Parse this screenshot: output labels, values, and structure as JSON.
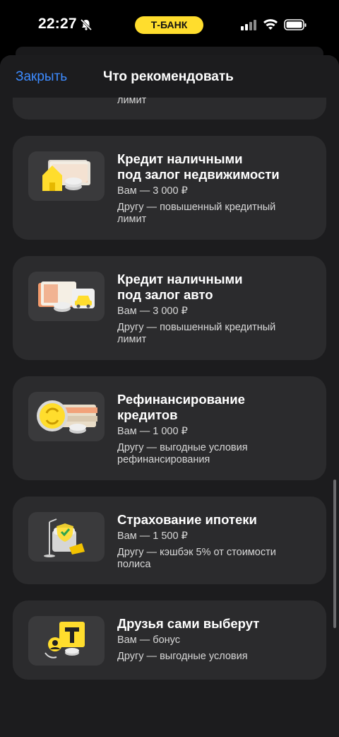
{
  "status": {
    "time": "22:27",
    "bank_label": "Т-БАНК"
  },
  "header": {
    "close_label": "Закрыть",
    "title": "Что рекомендовать"
  },
  "partial_card": {
    "text": "лимит"
  },
  "cards": [
    {
      "title_1": "Кредит наличными",
      "title_2": "под залог недвижимости",
      "you": "Вам — 3 000 ₽",
      "friend_1": "Другу — повышенный кредитный",
      "friend_2": "лимит",
      "icon": "house-money-icon"
    },
    {
      "title_1": "Кредит наличными",
      "title_2": "под залог авто",
      "you": "Вам — 3 000 ₽",
      "friend_1": "Другу — повышенный кредитный",
      "friend_2": "лимит",
      "icon": "car-money-icon"
    },
    {
      "title_1": "Рефинансирование",
      "title_2": "кредитов",
      "you": "Вам — 1 000 ₽",
      "friend_1": "Другу — выгодные условия",
      "friend_2": "рефинансирования",
      "icon": "refinance-coins-icon"
    },
    {
      "title_1": "Страхование ипотеки",
      "you": "Вам — 1 500 ₽",
      "friend_1": "Другу — кэшбэк 5% от стоимости",
      "friend_2": "полиса",
      "icon": "insurance-shield-icon"
    },
    {
      "title_1": "Друзья сами выберут",
      "you": "Вам — бонус",
      "friend_1": "Другу — выгодные условия",
      "icon": "tbank-friends-icon"
    }
  ],
  "colors": {
    "accent": "#ffdd2d",
    "link": "#3d8bff",
    "card": "#2b2b2d",
    "sheet": "#1c1c1e"
  }
}
